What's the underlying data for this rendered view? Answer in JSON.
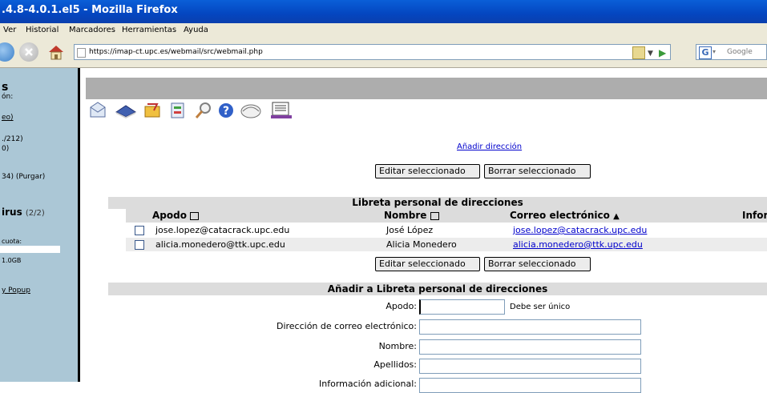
{
  "window": {
    "title": ".4.8-4.0.1.el5 - Mozilla Firefox"
  },
  "menu": {
    "items": [
      "Ver",
      "Historial",
      "Marcadores",
      "Herramientas",
      "Ayuda"
    ]
  },
  "browser": {
    "url": "https://imap-ct.upc.es/webmail/src/webmail.php",
    "search_placeholder": "Google"
  },
  "left_panel": {
    "heading": "s",
    "line2": "ón:",
    "link1": "eo)",
    "folder1": "./212)",
    "folder1b": "0)",
    "trash": "34)  (Purgar)",
    "virus_label": "irus",
    "virus_count": "(2/2)",
    "quota_label": "cuota:",
    "quota_value": "1.0GB",
    "popup_link": "y Popup"
  },
  "main": {
    "add_address_link": "Añadir dirección",
    "edit_selected": "Editar seleccionado",
    "delete_selected": "Borrar seleccionado",
    "addressbook_title": "Libreta personal de direcciones",
    "columns": [
      "Apodo",
      "Nombre",
      "Correo electrónico",
      "Infor"
    ],
    "rows": [
      {
        "nick": "jose.lopez@catacrack.upc.edu",
        "name": "José López",
        "email": "jose.lopez@catacrack.upc.edu"
      },
      {
        "nick": "alicia.monedero@ttk.upc.edu",
        "name": "Alicia Monedero",
        "email": "alicia.monedero@ttk.upc.edu"
      }
    ],
    "add_title": "Añadir a Libreta personal de direcciones",
    "form": {
      "nick_label": "Apodo:",
      "nick_note": "Debe ser único",
      "email_label": "Dirección de correo electrónico:",
      "name_label": "Nombre:",
      "surname_label": "Apellidos:",
      "info_label": "Información adicional:"
    }
  }
}
